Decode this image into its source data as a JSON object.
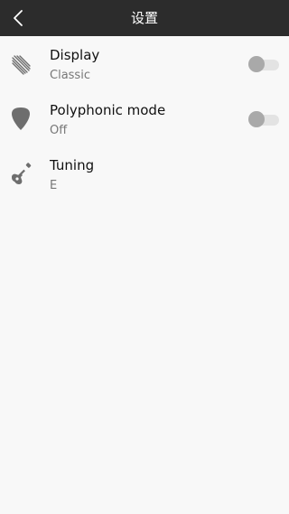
{
  "header": {
    "title": "设置",
    "back_icon": "chevron-left-icon"
  },
  "settings": [
    {
      "icon": "display-lines-icon",
      "title": "Display",
      "value": "Classic",
      "toggle": {
        "on": false
      }
    },
    {
      "icon": "guitar-pick-icon",
      "title": "Polyphonic mode",
      "value": "Off",
      "toggle": {
        "on": false
      }
    },
    {
      "icon": "guitar-icon",
      "title": "Tuning",
      "value": "E"
    }
  ],
  "colors": {
    "app_bar": "#2c2c2c",
    "background": "#f8f8f8",
    "icon": "#6e6e6e",
    "toggle_track_off": "#e3e3e3",
    "toggle_knob_off": "#a9a9a9"
  }
}
